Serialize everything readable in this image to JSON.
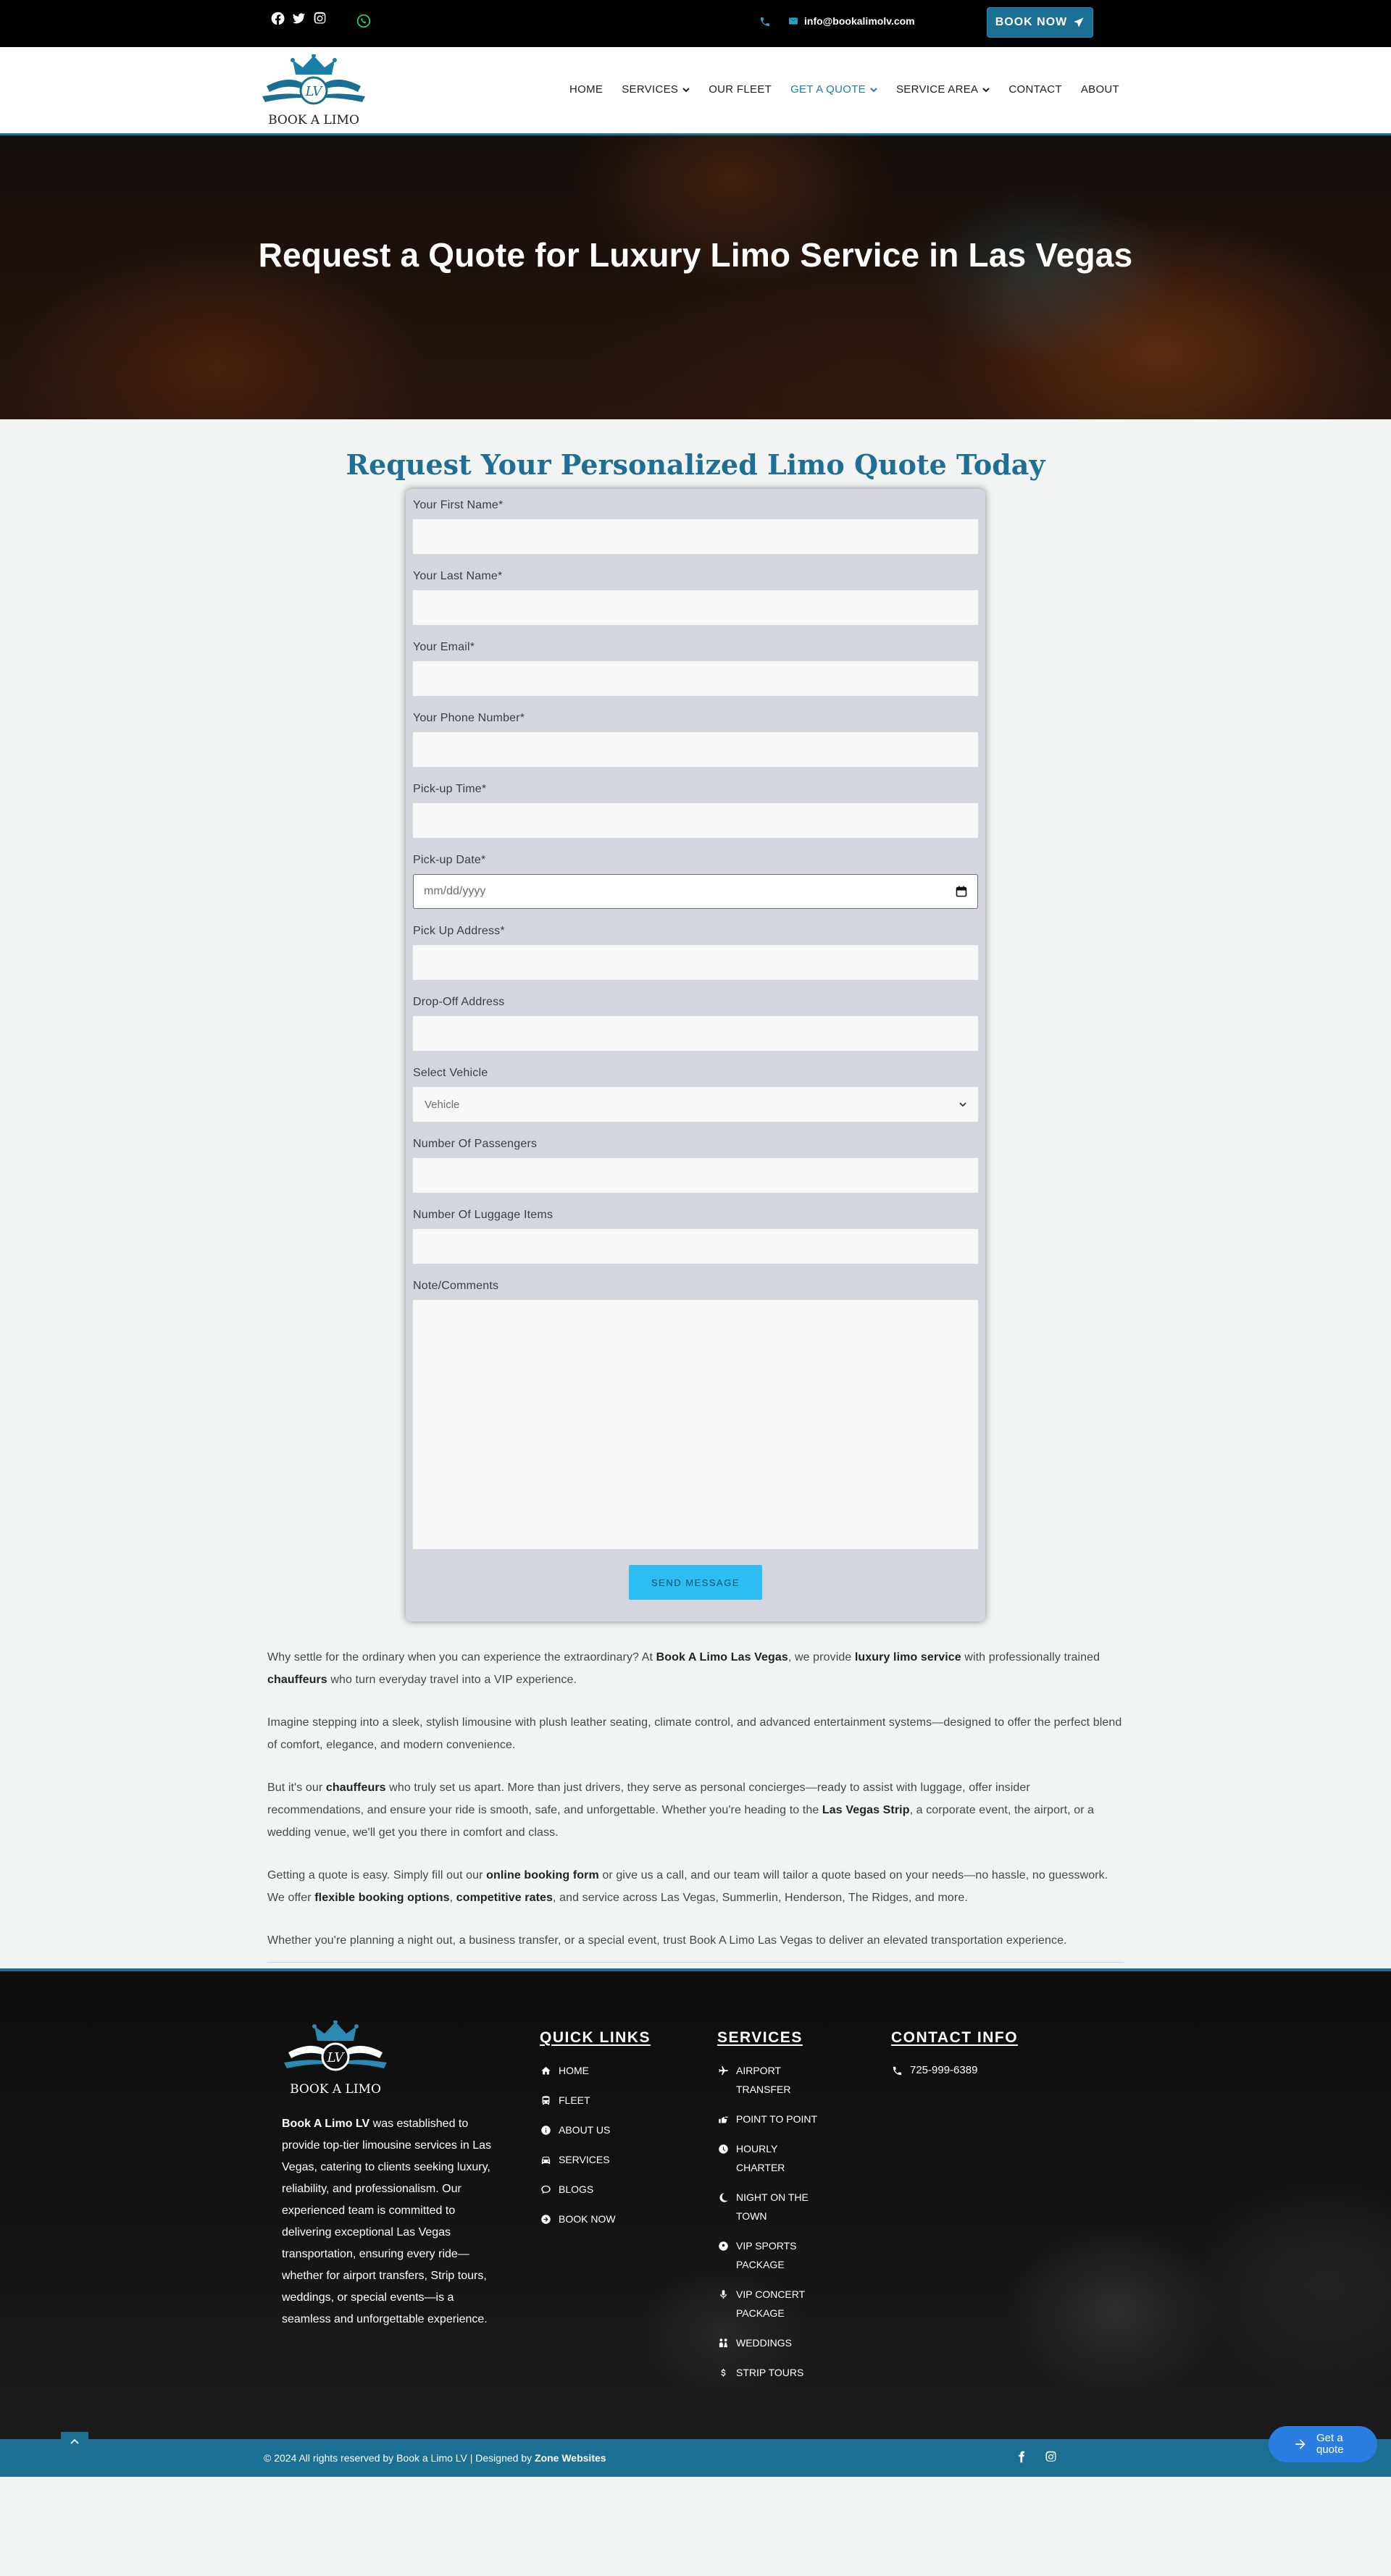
{
  "topbar": {
    "email": "info@bookalimolv.com",
    "book_now": "BOOK NOW",
    "icons": [
      "facebook-icon",
      "twitter-icon",
      "instagram-icon",
      "whatsapp-icon",
      "phone-icon",
      "envelope-icon",
      "paper-plane-icon"
    ]
  },
  "header": {
    "logo_text": "BOOK A LIMO",
    "logo_monogram": "LV",
    "nav": [
      {
        "label": "HOME",
        "dropdown": false
      },
      {
        "label": "SERVICES",
        "dropdown": true
      },
      {
        "label": "OUR FLEET",
        "dropdown": false
      },
      {
        "label": "GET A QUOTE",
        "dropdown": true
      },
      {
        "label": "SERVICE AREA",
        "dropdown": true
      },
      {
        "label": "CONTACT",
        "dropdown": false
      },
      {
        "label": "ABOUT",
        "dropdown": false
      }
    ],
    "active_nav": "GET A QUOTE"
  },
  "hero": {
    "title": "Request a Quote for Luxury Limo Service in Las Vegas"
  },
  "quote": {
    "section_title": "Request Your Personalized Limo Quote Today",
    "fields": {
      "first_name": "Your First Name*",
      "last_name": "Your Last Name*",
      "email": "Your Email*",
      "phone": "Your Phone Number*",
      "pickup_time": "Pick-up Time*",
      "pickup_date": "Pick-up Date*",
      "pickup_date_placeholder": "mm/dd/yyyy",
      "pickup_address": "Pick Up Address*",
      "dropoff_address": "Drop-Off Address",
      "vehicle": "Select Vehicle",
      "vehicle_selected": "Vehicle",
      "passengers": "Number Of Passengers",
      "luggage": "Number Of Luggage Items",
      "notes": "Note/Comments"
    },
    "submit": "SEND MESSAGE"
  },
  "content": {
    "p1": [
      "Why settle for the ordinary when you can experience the extraordinary? At ",
      "Book A Limo Las Vegas",
      ", we provide ",
      "luxury limo service",
      " with professionally trained ",
      "chauffeurs",
      " who turn everyday travel into a VIP experience."
    ],
    "p2": "Imagine stepping into a sleek, stylish limousine with plush leather seating, climate control, and advanced entertainment systems—designed to offer the perfect blend of comfort, elegance, and modern convenience.",
    "p3": [
      "But it's our ",
      "chauffeurs",
      " who truly set us apart. More than just drivers, they serve as personal concierges—ready to assist with luggage, offer insider recommendations, and ensure your ride is smooth, safe, and unforgettable. Whether you're heading to the ",
      "Las Vegas Strip",
      ", a corporate event, the airport, or a wedding venue, we'll get you there in comfort and class."
    ],
    "p4": [
      "Getting a quote is easy. Simply fill out our ",
      "online booking form",
      " or give us a call, and our team will tailor a quote based on your needs—no hassle, no guesswork. We offer ",
      "flexible booking options",
      ", ",
      "competitive rates",
      ", and service across Las Vegas, Summerlin, Henderson, The Ridges, and more."
    ],
    "p5": "Whether you're planning a night out, a business transfer, or a special event, trust Book A Limo Las Vegas to deliver an elevated transportation experience."
  },
  "footer": {
    "about_brand": "Book A Limo LV",
    "about_text": " was established to provide top-tier limousine services in Las Vegas, catering to clients seeking luxury, reliability, and professionalism. Our experienced team is committed to delivering exceptional Las Vegas transportation, ensuring every ride—whether for airport transfers, Strip tours, weddings, or special events—is a seamless and unforgettable experience.",
    "quick_links_title": "QUICK LINKS",
    "quick_links": [
      {
        "label": "HOME",
        "icon": "home-icon"
      },
      {
        "label": "FLEET",
        "icon": "bus-icon"
      },
      {
        "label": "ABOUT US",
        "icon": "info-circle-icon"
      },
      {
        "label": "SERVICES",
        "icon": "car-icon"
      },
      {
        "label": "BLOGS",
        "icon": "comment-icon"
      },
      {
        "label": "BOOK NOW",
        "icon": "arrow-circle-icon"
      }
    ],
    "services_title": "SERVICES",
    "services": [
      {
        "label": "AIRPORT TRANSFER",
        "icon": "plane-icon"
      },
      {
        "label": "POINT TO POINT",
        "icon": "hand-point-icon"
      },
      {
        "label": "HOURLY CHARTER",
        "icon": "clock-icon"
      },
      {
        "label": "NIGHT ON THE TOWN",
        "icon": "moon-icon"
      },
      {
        "label": "VIP SPORTS PACKAGE",
        "icon": "football-icon"
      },
      {
        "label": "VIP CONCERT PACKAGE",
        "icon": "microphone-icon"
      },
      {
        "label": "WEDDINGS",
        "icon": "couple-icon"
      },
      {
        "label": "STRIP TOURS",
        "icon": "dollar-icon"
      }
    ],
    "contact_title": "CONTACT INFO",
    "phone": "725-999-6389"
  },
  "bottom": {
    "copyright": "© 2024 All rights reserved by Book a Limo LV | Designed by ",
    "designer": "Zone Websites",
    "get_quote": "Get a quote"
  },
  "colors": {
    "brand": "#1a6f93",
    "accent": "#27a4c6",
    "send_button": "#2cbef2",
    "quote_button": "#2a7de1"
  }
}
